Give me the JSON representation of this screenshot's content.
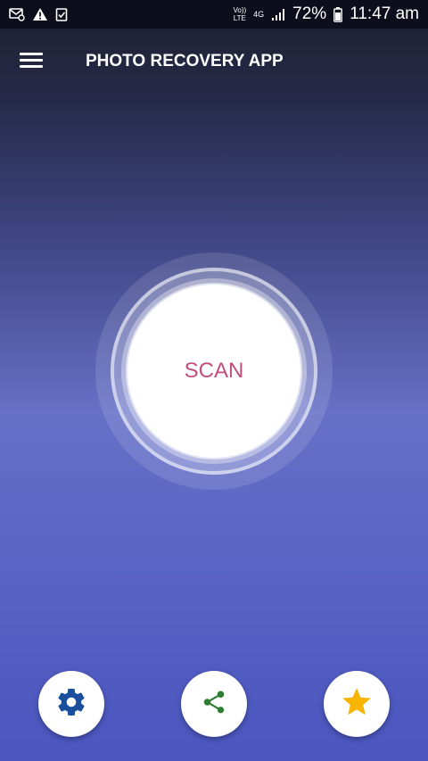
{
  "status_bar": {
    "network_label_top": "Vo))",
    "network_label_bottom": "LTE",
    "data_type": "4G",
    "battery": "72%",
    "time": "11:47 am",
    "icons": [
      "mail-icon",
      "warning-icon",
      "clipboard-check-icon",
      "signal-icon",
      "battery-icon"
    ]
  },
  "app_bar": {
    "title": "PHOTO RECOVERY APP",
    "menu_icon": "hamburger-menu-icon"
  },
  "scan": {
    "label": "SCAN"
  },
  "bottom_actions": [
    {
      "icon": "gear-icon",
      "color": "#1a4f9e"
    },
    {
      "icon": "share-icon",
      "color": "#2e7d32"
    },
    {
      "icon": "star-icon",
      "color": "#f7b500"
    }
  ],
  "colors": {
    "scan_text": "#c1507e",
    "status_bar": "#0c0e1c",
    "background_top": "#1c1f2e",
    "background_bottom": "#4a55bf"
  }
}
